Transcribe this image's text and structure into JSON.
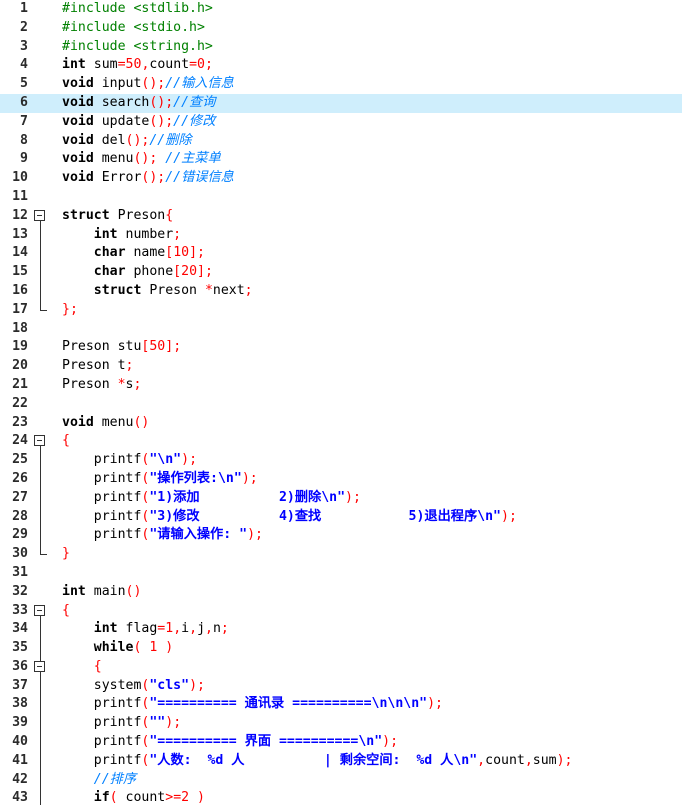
{
  "editor": {
    "highlighted_line": 6,
    "lines": [
      {
        "n": "1",
        "fold": "",
        "tokens": [
          [
            "pre",
            "#include <stdlib.h>"
          ]
        ]
      },
      {
        "n": "2",
        "fold": "",
        "tokens": [
          [
            "pre",
            "#include <stdio.h>"
          ]
        ]
      },
      {
        "n": "3",
        "fold": "",
        "tokens": [
          [
            "pre",
            "#include <string.h>"
          ]
        ]
      },
      {
        "n": "4",
        "fold": "",
        "tokens": [
          [
            "kw",
            "int"
          ],
          [
            "id",
            " sum"
          ],
          [
            "op",
            "="
          ],
          [
            "num",
            "50"
          ],
          [
            "op",
            ","
          ],
          [
            "id",
            "count"
          ],
          [
            "op",
            "="
          ],
          [
            "num",
            "0"
          ],
          [
            "op",
            ";"
          ]
        ]
      },
      {
        "n": "5",
        "fold": "",
        "tokens": [
          [
            "kw",
            "void"
          ],
          [
            "id",
            " input"
          ],
          [
            "op",
            "();"
          ],
          [
            "cmt",
            "//输入信息"
          ]
        ]
      },
      {
        "n": "6",
        "fold": "",
        "tokens": [
          [
            "kw",
            "void"
          ],
          [
            "id",
            " search"
          ],
          [
            "op",
            "();"
          ],
          [
            "cmt",
            "//查询"
          ]
        ]
      },
      {
        "n": "7",
        "fold": "",
        "tokens": [
          [
            "kw",
            "void"
          ],
          [
            "id",
            " update"
          ],
          [
            "op",
            "();"
          ],
          [
            "cmt",
            "//修改"
          ]
        ]
      },
      {
        "n": "8",
        "fold": "",
        "tokens": [
          [
            "kw",
            "void"
          ],
          [
            "id",
            " del"
          ],
          [
            "op",
            "();"
          ],
          [
            "cmt",
            "//删除"
          ]
        ]
      },
      {
        "n": "9",
        "fold": "",
        "tokens": [
          [
            "kw",
            "void"
          ],
          [
            "id",
            " menu"
          ],
          [
            "op",
            "();"
          ],
          [
            "id",
            " "
          ],
          [
            "cmt",
            "//主菜单"
          ]
        ]
      },
      {
        "n": "10",
        "fold": "",
        "tokens": [
          [
            "kw",
            "void"
          ],
          [
            "id",
            " Error"
          ],
          [
            "op",
            "();"
          ],
          [
            "cmt",
            "//错误信息"
          ]
        ]
      },
      {
        "n": "11",
        "fold": "",
        "tokens": []
      },
      {
        "n": "12",
        "fold": "open",
        "tokens": [
          [
            "kw",
            "struct"
          ],
          [
            "id",
            " Preson"
          ],
          [
            "op",
            "{"
          ]
        ]
      },
      {
        "n": "13",
        "fold": "line",
        "tokens": [
          [
            "id",
            "    "
          ],
          [
            "kw",
            "int"
          ],
          [
            "id",
            " number"
          ],
          [
            "op",
            ";"
          ]
        ]
      },
      {
        "n": "14",
        "fold": "line",
        "tokens": [
          [
            "id",
            "    "
          ],
          [
            "kw",
            "char"
          ],
          [
            "id",
            " name"
          ],
          [
            "op",
            "["
          ],
          [
            "num",
            "10"
          ],
          [
            "op",
            "];"
          ]
        ]
      },
      {
        "n": "15",
        "fold": "line",
        "tokens": [
          [
            "id",
            "    "
          ],
          [
            "kw",
            "char"
          ],
          [
            "id",
            " phone"
          ],
          [
            "op",
            "["
          ],
          [
            "num",
            "20"
          ],
          [
            "op",
            "];"
          ]
        ]
      },
      {
        "n": "16",
        "fold": "line",
        "tokens": [
          [
            "id",
            "    "
          ],
          [
            "kw",
            "struct"
          ],
          [
            "id",
            " Preson "
          ],
          [
            "op",
            "*"
          ],
          [
            "id",
            "next"
          ],
          [
            "op",
            ";"
          ]
        ]
      },
      {
        "n": "17",
        "fold": "end",
        "tokens": [
          [
            "op",
            "};"
          ]
        ]
      },
      {
        "n": "18",
        "fold": "",
        "tokens": []
      },
      {
        "n": "19",
        "fold": "",
        "tokens": [
          [
            "id",
            "Preson stu"
          ],
          [
            "op",
            "["
          ],
          [
            "num",
            "50"
          ],
          [
            "op",
            "];"
          ]
        ]
      },
      {
        "n": "20",
        "fold": "",
        "tokens": [
          [
            "id",
            "Preson t"
          ],
          [
            "op",
            ";"
          ]
        ]
      },
      {
        "n": "21",
        "fold": "",
        "tokens": [
          [
            "id",
            "Preson "
          ],
          [
            "op",
            "*"
          ],
          [
            "id",
            "s"
          ],
          [
            "op",
            ";"
          ]
        ]
      },
      {
        "n": "22",
        "fold": "",
        "tokens": []
      },
      {
        "n": "23",
        "fold": "",
        "tokens": [
          [
            "kw",
            "void"
          ],
          [
            "id",
            " menu"
          ],
          [
            "op",
            "()"
          ]
        ]
      },
      {
        "n": "24",
        "fold": "open",
        "tokens": [
          [
            "op",
            "{"
          ]
        ]
      },
      {
        "n": "25",
        "fold": "line",
        "tokens": [
          [
            "id",
            "    printf"
          ],
          [
            "op",
            "("
          ],
          [
            "str",
            "\"\\n\""
          ],
          [
            "op",
            ");"
          ]
        ]
      },
      {
        "n": "26",
        "fold": "line",
        "tokens": [
          [
            "id",
            "    printf"
          ],
          [
            "op",
            "("
          ],
          [
            "str",
            "\"操作列表:\\n\""
          ],
          [
            "op",
            ");"
          ]
        ]
      },
      {
        "n": "27",
        "fold": "line",
        "tokens": [
          [
            "id",
            "    printf"
          ],
          [
            "op",
            "("
          ],
          [
            "str",
            "\"1)添加          2)删除\\n\""
          ],
          [
            "op",
            ");"
          ]
        ]
      },
      {
        "n": "28",
        "fold": "line",
        "tokens": [
          [
            "id",
            "    printf"
          ],
          [
            "op",
            "("
          ],
          [
            "str",
            "\"3)修改          4)查找           5)退出程序\\n\""
          ],
          [
            "op",
            ");"
          ]
        ]
      },
      {
        "n": "29",
        "fold": "line",
        "tokens": [
          [
            "id",
            "    printf"
          ],
          [
            "op",
            "("
          ],
          [
            "str",
            "\"请输入操作: \""
          ],
          [
            "op",
            ");"
          ]
        ]
      },
      {
        "n": "30",
        "fold": "end",
        "tokens": [
          [
            "op",
            "}"
          ]
        ]
      },
      {
        "n": "31",
        "fold": "",
        "tokens": []
      },
      {
        "n": "32",
        "fold": "",
        "tokens": [
          [
            "kw",
            "int"
          ],
          [
            "id",
            " main"
          ],
          [
            "op",
            "()"
          ]
        ]
      },
      {
        "n": "33",
        "fold": "open",
        "tokens": [
          [
            "op",
            "{"
          ]
        ]
      },
      {
        "n": "34",
        "fold": "line",
        "tokens": [
          [
            "id",
            "    "
          ],
          [
            "kw",
            "int"
          ],
          [
            "id",
            " flag"
          ],
          [
            "op",
            "="
          ],
          [
            "num",
            "1"
          ],
          [
            "op",
            ","
          ],
          [
            "id",
            "i"
          ],
          [
            "op",
            ","
          ],
          [
            "id",
            "j"
          ],
          [
            "op",
            ","
          ],
          [
            "id",
            "n"
          ],
          [
            "op",
            ";"
          ]
        ]
      },
      {
        "n": "35",
        "fold": "line",
        "tokens": [
          [
            "id",
            "    "
          ],
          [
            "kw",
            "while"
          ],
          [
            "op",
            "("
          ],
          [
            "id",
            " "
          ],
          [
            "num",
            "1"
          ],
          [
            "id",
            " "
          ],
          [
            "op",
            ")"
          ]
        ]
      },
      {
        "n": "36",
        "fold": "open2",
        "tokens": [
          [
            "id",
            "    "
          ],
          [
            "op",
            "{"
          ]
        ]
      },
      {
        "n": "37",
        "fold": "line",
        "tokens": [
          [
            "id",
            "    system"
          ],
          [
            "op",
            "("
          ],
          [
            "str",
            "\"cls\""
          ],
          [
            "op",
            ");"
          ]
        ]
      },
      {
        "n": "38",
        "fold": "line",
        "tokens": [
          [
            "id",
            "    printf"
          ],
          [
            "op",
            "("
          ],
          [
            "str",
            "\"========== 通讯录 ==========\\n\\n\\n\""
          ],
          [
            "op",
            ");"
          ]
        ]
      },
      {
        "n": "39",
        "fold": "line",
        "tokens": [
          [
            "id",
            "    printf"
          ],
          [
            "op",
            "("
          ],
          [
            "str",
            "\"\""
          ],
          [
            "op",
            ");"
          ]
        ]
      },
      {
        "n": "40",
        "fold": "line",
        "tokens": [
          [
            "id",
            "    printf"
          ],
          [
            "op",
            "("
          ],
          [
            "str",
            "\"========== 界面 ==========\\n\""
          ],
          [
            "op",
            ");"
          ]
        ]
      },
      {
        "n": "41",
        "fold": "line",
        "tokens": [
          [
            "id",
            "    printf"
          ],
          [
            "op",
            "("
          ],
          [
            "str",
            "\"人数:  %d 人          | 剩余空间:  %d 人\\n\""
          ],
          [
            "op",
            ","
          ],
          [
            "id",
            "count"
          ],
          [
            "op",
            ","
          ],
          [
            "id",
            "sum"
          ],
          [
            "op",
            ");"
          ]
        ]
      },
      {
        "n": "42",
        "fold": "line",
        "tokens": [
          [
            "id",
            "    "
          ],
          [
            "cmt",
            "//排序"
          ]
        ]
      },
      {
        "n": "43",
        "fold": "line",
        "tokens": [
          [
            "id",
            "    "
          ],
          [
            "kw",
            "if"
          ],
          [
            "op",
            "("
          ],
          [
            "id",
            " count"
          ],
          [
            "op",
            ">="
          ],
          [
            "num",
            "2"
          ],
          [
            "id",
            " "
          ],
          [
            "op",
            ")"
          ]
        ]
      }
    ]
  }
}
